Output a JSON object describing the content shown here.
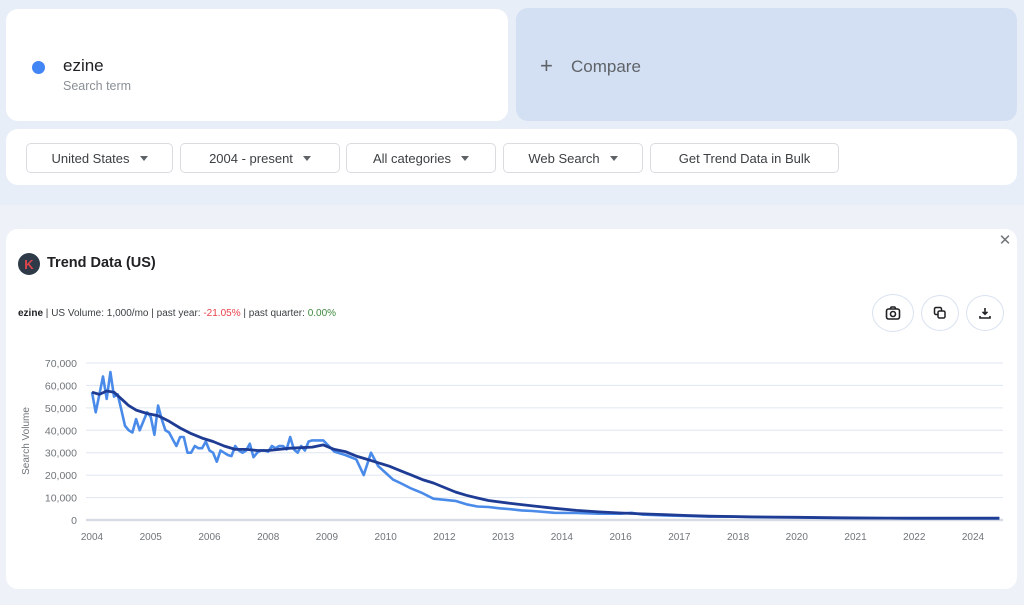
{
  "search_term": {
    "name": "ezine",
    "subtitle": "Search term",
    "color": "#4285f4"
  },
  "compare": {
    "icon": "plus-icon",
    "label": "Compare"
  },
  "filters": [
    {
      "label": "United States",
      "dropdown": true
    },
    {
      "label": "2004 - present",
      "dropdown": true
    },
    {
      "label": "All categories",
      "dropdown": true
    },
    {
      "label": "Web Search",
      "dropdown": true
    },
    {
      "label": "Get Trend Data in Bulk",
      "dropdown": false
    }
  ],
  "trend_panel": {
    "logo_letter": "K",
    "title": "Trend Data (US)",
    "close_icon": "close-icon",
    "stats": {
      "term": "ezine",
      "volume": "US Volume: 1,000/mo",
      "past_year_label": "past year:",
      "past_year_value": "-21.05%",
      "past_quarter_label": "past quarter:",
      "past_quarter_value": "0.00%"
    },
    "actions": [
      {
        "icon": "camera-icon",
        "label": "Screenshot"
      },
      {
        "icon": "copy-icon",
        "label": "Copy"
      },
      {
        "icon": "download-icon",
        "label": "Download"
      }
    ]
  },
  "chart_data": {
    "type": "line",
    "title": "",
    "xlabel": "",
    "ylabel": "Search Volume",
    "ylim": [
      0,
      70000
    ],
    "xlim": [
      2004.0,
      2024.6
    ],
    "yticks": [
      "0",
      "10,000",
      "20,000",
      "30,000",
      "40,000",
      "50,000",
      "60,000",
      "70,000"
    ],
    "ytick_values": [
      0,
      10000,
      20000,
      30000,
      40000,
      50000,
      60000,
      70000
    ],
    "xtick_labels": [
      "2004",
      "2005",
      "2006",
      "2008",
      "2009",
      "2010",
      "2012",
      "2013",
      "2014",
      "2016",
      "2017",
      "2018",
      "2020",
      "2021",
      "2022",
      "2024"
    ],
    "xtick_values": [
      2004.0,
      2005.333,
      2006.667,
      2008.0,
      2009.333,
      2010.667,
      2012.0,
      2013.333,
      2014.667,
      2016.0,
      2017.333,
      2018.667,
      2020.0,
      2021.333,
      2022.667,
      2024.0
    ],
    "grid": true,
    "legend": "none",
    "series": [
      {
        "name": "ezine (monthly volume)",
        "color": "#4a8bea",
        "x": [
          2004.0,
          2004.083,
          2004.167,
          2004.25,
          2004.333,
          2004.417,
          2004.5,
          2004.583,
          2004.667,
          2004.75,
          2004.833,
          2004.917,
          2005.0,
          2005.083,
          2005.167,
          2005.25,
          2005.333,
          2005.417,
          2005.5,
          2005.583,
          2005.667,
          2005.75,
          2005.833,
          2005.917,
          2006.0,
          2006.083,
          2006.167,
          2006.25,
          2006.333,
          2006.417,
          2006.5,
          2006.583,
          2006.667,
          2006.75,
          2006.833,
          2006.917,
          2007.0,
          2007.083,
          2007.167,
          2007.25,
          2007.333,
          2007.417,
          2007.5,
          2007.583,
          2007.667,
          2007.75,
          2007.833,
          2007.917,
          2008.0,
          2008.083,
          2008.167,
          2008.25,
          2008.333,
          2008.417,
          2008.5,
          2008.583,
          2008.667,
          2008.75,
          2008.833,
          2008.917,
          2009.0,
          2009.25,
          2009.5,
          2009.75,
          2010.0,
          2010.167,
          2010.333,
          2010.5,
          2010.667,
          2010.833,
          2011.0,
          2011.25,
          2011.5,
          2011.75,
          2012.0,
          2012.25,
          2012.5,
          2012.75,
          2013.0,
          2013.25,
          2013.5,
          2013.75,
          2014.0,
          2014.5,
          2015.0,
          2015.5,
          2016.0,
          2016.25,
          2016.5,
          2017.0,
          2017.5,
          2018.0,
          2018.5,
          2019.0,
          2019.5,
          2020.0,
          2020.5,
          2021.0,
          2021.5,
          2022.0,
          2022.5,
          2023.0,
          2023.5,
          2024.0,
          2024.6
        ],
        "values": [
          57000,
          48000,
          56000,
          64000,
          54000,
          66000,
          55000,
          56000,
          49000,
          42000,
          40000,
          39000,
          45000,
          40000,
          44000,
          48000,
          46000,
          38000,
          51000,
          45000,
          40000,
          39000,
          36000,
          33000,
          37000,
          37000,
          30000,
          30000,
          33000,
          32000,
          32000,
          35000,
          31000,
          30000,
          26000,
          31000,
          30000,
          29000,
          28500,
          33000,
          31000,
          30000,
          31000,
          34000,
          28000,
          30000,
          31000,
          31000,
          30500,
          33000,
          32000,
          33000,
          33000,
          31500,
          37000,
          31500,
          30000,
          33000,
          31000,
          35000,
          35500,
          35500,
          30500,
          29000,
          27000,
          20000,
          30000,
          24000,
          21000,
          18000,
          16500,
          14000,
          12000,
          9500,
          9000,
          8500,
          7000,
          6000,
          5800,
          5200,
          4800,
          4300,
          4000,
          3200,
          3100,
          2800,
          2800,
          3200,
          2400,
          2000,
          1800,
          1500,
          1500,
          1300,
          1200,
          1200,
          1000,
          900,
          800,
          800,
          700,
          700,
          700,
          700,
          700
        ]
      },
      {
        "name": "ezine (trend)",
        "color": "#1f3c94",
        "x": [
          2004.0,
          2004.167,
          2004.333,
          2004.5,
          2004.667,
          2004.833,
          2005.0,
          2005.25,
          2005.5,
          2005.75,
          2006.0,
          2006.25,
          2006.5,
          2006.75,
          2007.0,
          2007.25,
          2007.5,
          2007.75,
          2008.0,
          2008.5,
          2009.0,
          2009.25,
          2009.5,
          2009.75,
          2010.0,
          2010.25,
          2010.5,
          2010.75,
          2011.0,
          2011.25,
          2011.5,
          2011.75,
          2012.0,
          2012.25,
          2012.5,
          2012.75,
          2013.0,
          2013.5,
          2014.0,
          2014.5,
          2015.0,
          2015.5,
          2016.0,
          2016.5,
          2017.0,
          2017.5,
          2018.0,
          2019.0,
          2020.0,
          2021.0,
          2022.0,
          2023.0,
          2024.0,
          2024.6
        ],
        "values": [
          57000,
          56000,
          57500,
          57000,
          54000,
          51000,
          49000,
          47500,
          46500,
          44000,
          41000,
          38500,
          36500,
          35000,
          33000,
          31500,
          31500,
          31000,
          31000,
          32000,
          32500,
          33500,
          31500,
          30500,
          28500,
          27000,
          25500,
          24000,
          22000,
          20000,
          18000,
          16500,
          14500,
          12500,
          11000,
          9800,
          8700,
          7400,
          6300,
          5200,
          4300,
          3600,
          3100,
          2700,
          2400,
          2000,
          1700,
          1400,
          1200,
          1000,
          850,
          800,
          800,
          800
        ]
      }
    ]
  }
}
